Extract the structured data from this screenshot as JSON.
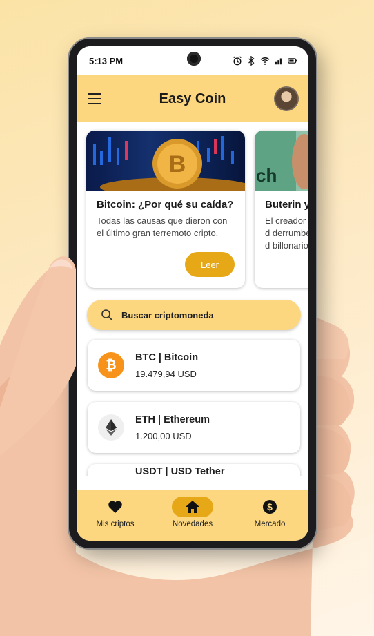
{
  "status_bar": {
    "time": "5:13 PM"
  },
  "app_bar": {
    "title": "Easy Coin"
  },
  "news": [
    {
      "title": "Bitcoin: ¿Por qué su caída?",
      "text": "Todas las causas que dieron con el último gran terremoto cripto.",
      "button": "Leer"
    },
    {
      "title": "Buterin y",
      "text": "El creador d derrumbe d billonario\"",
      "button": ""
    }
  ],
  "search": {
    "placeholder": "Buscar criptomoneda"
  },
  "coins": [
    {
      "name": "BTC | Bitcoin",
      "price": "19.479,94 USD",
      "icon": "bitcoin-icon",
      "color": "#f7931a"
    },
    {
      "name": "ETH | Ethereum",
      "price": "1.200,00 USD",
      "icon": "ethereum-icon",
      "color": "#3c3c3d"
    },
    {
      "name": "USDT | USD Tether",
      "price": "",
      "icon": "tether-icon",
      "color": "#26a17b"
    }
  ],
  "bottom_nav": [
    {
      "label": "Mis criptos",
      "icon": "heart-icon"
    },
    {
      "label": "Novedades",
      "icon": "home-icon",
      "active": true
    },
    {
      "label": "Mercado",
      "icon": "dollar-icon"
    }
  ],
  "colors": {
    "primary": "#fcd77f",
    "accent": "#e6a817"
  }
}
